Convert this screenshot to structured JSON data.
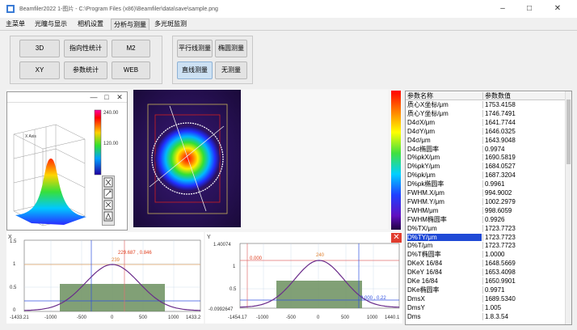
{
  "window": {
    "title": "Beamfiler2022 1-图片 - C:\\Program Files (x86)\\Beamfiler\\data\\save\\sample.png",
    "minimize": "–",
    "maximize": "□",
    "close": "✕"
  },
  "tabs": [
    "主菜单",
    "光瞳与显示",
    "相机设置",
    "分析与测量",
    "多光斑监测"
  ],
  "active_tab": "分析与测量",
  "left_panel": {
    "buttons": [
      "3D",
      "指向性统计",
      "M2",
      "XY",
      "参数统计",
      "WEB"
    ]
  },
  "right_panel": {
    "buttons": [
      "平行线测量",
      "椭圆测量",
      "直线测量",
      "无测量"
    ],
    "active": "直线测量"
  },
  "window_3d": {
    "minimize": "—",
    "maximize": "□",
    "close": "✕",
    "axis_label": "X Axis",
    "colorbar_ticks": [
      "240.00",
      "120.00"
    ]
  },
  "tool_icons": [
    "zoom-icon",
    "rotate-icon",
    "move-icon",
    "reset-icon"
  ],
  "param_table": {
    "header_name": "参数名称",
    "header_value": "参数数值",
    "rows": [
      [
        "质心X坐标/μm",
        "1753.4158"
      ],
      [
        "质心Y坐标/μm",
        "1746.7491"
      ],
      [
        "D4σX/μm",
        "1641.7744"
      ],
      [
        "D4σY/μm",
        "1646.0325"
      ],
      [
        "D4σ/μm",
        "1643.9048"
      ],
      [
        "D4σ椭圆率",
        "0.9974"
      ],
      [
        "D%pkX/μm",
        "1690.5819"
      ],
      [
        "D%pkY/μm",
        "1684.0527"
      ],
      [
        "D%pk/μm",
        "1687.3204"
      ],
      [
        "D%pk椭圆率",
        "0.9961"
      ],
      [
        "FWHM.X/μm",
        "994.9002"
      ],
      [
        "FWHM.Y/μm",
        "1002.2979"
      ],
      [
        "FWHM/μm",
        "998.6059"
      ],
      [
        "FWHM椭圆率",
        "0.9926"
      ],
      [
        "D%TX/μm",
        "1723.7723"
      ],
      [
        "D%TY/μm",
        "1723.7723"
      ],
      [
        "D%T/μm",
        "1723.7723"
      ],
      [
        "D%T椭圆率",
        "1.0000"
      ],
      [
        "DKeX 16/84",
        "1648.5669"
      ],
      [
        "DKeY 16/84",
        "1653.4098"
      ],
      [
        "DKe 16/84",
        "1650.9901"
      ],
      [
        "DKe椭圆率",
        "0.9971"
      ],
      [
        "DmsX",
        "1689.5340"
      ],
      [
        "DmsY",
        "1.005"
      ],
      [
        "Dms",
        "1.8.3.54"
      ]
    ],
    "selected_row": 15
  },
  "plot_x": {
    "axis_name": "X",
    "yticks": [
      "1.5",
      "1",
      "0.5",
      "0"
    ],
    "xticks": [
      "-1433.21",
      "-1000",
      "-500",
      "0",
      "500",
      "1000",
      "1433.2"
    ],
    "annotation": "229.687 , 0.846",
    "peak_label": "239"
  },
  "plot_y": {
    "axis_name": "Y",
    "ymax": "1.40074",
    "yticks": [
      "1",
      "0.5"
    ],
    "ymin": "-0.0992647",
    "xticks": [
      "-1454.17",
      "-1000",
      "-500",
      "0",
      "500",
      "1000",
      "1440.1"
    ],
    "annotation_left": "0.000",
    "peak_label": "240",
    "annotation_right": "0.000 , 0.22"
  },
  "colors": {
    "accent": "#1f49d6",
    "active_button": "#cde1f3",
    "fill_green": "#6b8f5e",
    "curve": "#6a2b8a",
    "close_red": "#e03c2e"
  }
}
